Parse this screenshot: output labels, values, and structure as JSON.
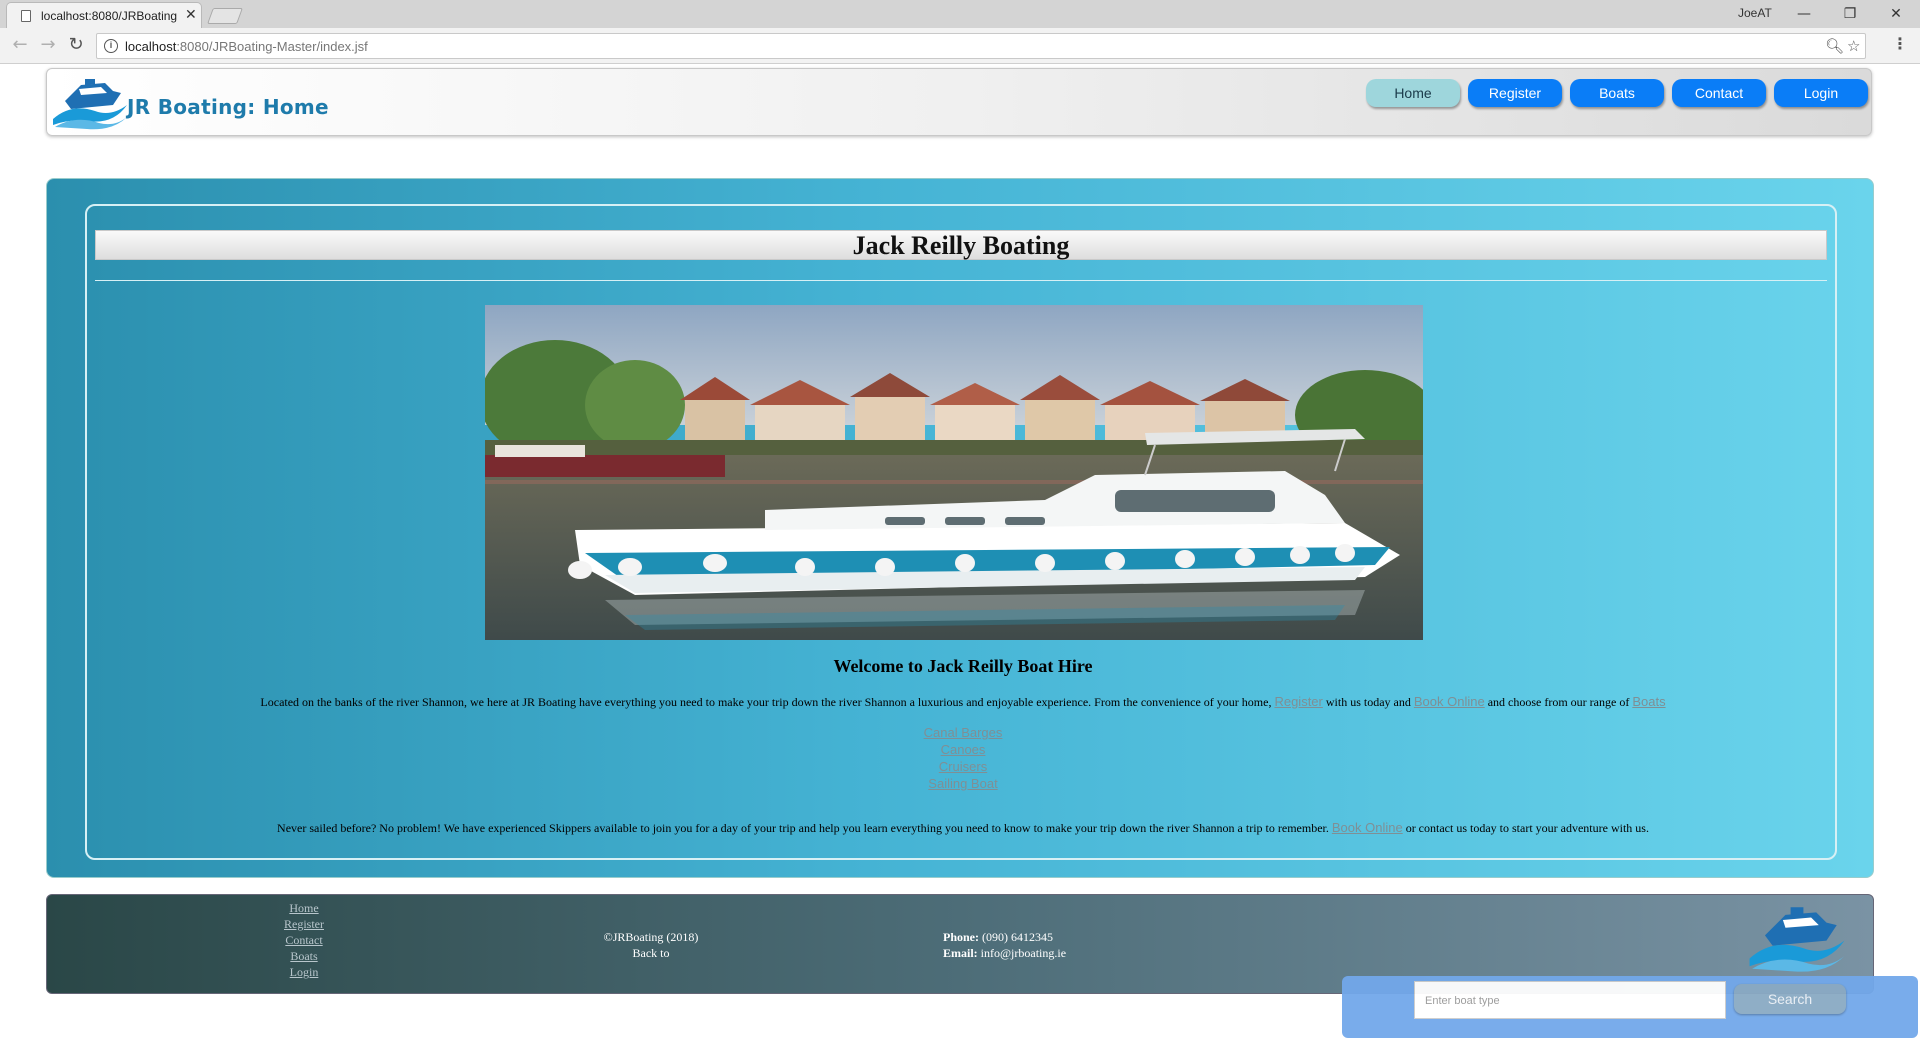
{
  "browser": {
    "tab_title": "localhost:8080/JRBoating",
    "url_host": "localhost",
    "url_path": ":8080/JRBoating-Master/index.jsf",
    "user": "JoeAT",
    "tab_close": "✕",
    "win_minimize": "—",
    "win_restore": "❐",
    "win_close": "✕"
  },
  "header": {
    "site_title": "JR Boating: Home",
    "nav": [
      "Home",
      "Register",
      "Boats",
      "Contact",
      "Login"
    ]
  },
  "main": {
    "heading": "Jack Reilly Boating",
    "welcome": "Welcome to Jack Reilly Boat Hire",
    "intro_text_1": "Located on the banks of the river Shannon, we here at JR Boating have everything you need to make your trip down the river Shannon a luxurious and enjoyable experience. From the convenience of your home,",
    "intro_link_register": "Register",
    "intro_text_2": "with us today and",
    "intro_link_book": "Book Online",
    "intro_text_3": "and choose from our range of",
    "intro_link_boats": "Boats",
    "boat_types": [
      "Canal Barges",
      "Canoes",
      "Cruisers",
      "Sailing Boat"
    ],
    "skipper_text_1": "Never sailed before? No problem! We have experienced Skippers available to join you for a day of your trip and help you learn everything you need to know to make your trip down the river Shannon a trip to remember.",
    "skipper_link_book": "Book Online",
    "skipper_text_2": "or contact us today to start your adventure with us."
  },
  "footer": {
    "links": [
      "Home",
      "Register",
      "Contact",
      "Boats",
      "Login"
    ],
    "copyright": "©JRBoating (2018)",
    "back_to": "Back to",
    "phone_label": "Phone:",
    "phone_value": "(090) 6412345",
    "email_label": "Email:",
    "email_value": "info@jrboating.ie"
  },
  "search": {
    "placeholder": "Enter boat type",
    "button_label": "Search"
  },
  "colors": {
    "nav_button": "#0a7df7",
    "nav_active": "#9ed6dc",
    "panel_teal": "#45b3d4",
    "title_blue": "#1e7bab"
  }
}
